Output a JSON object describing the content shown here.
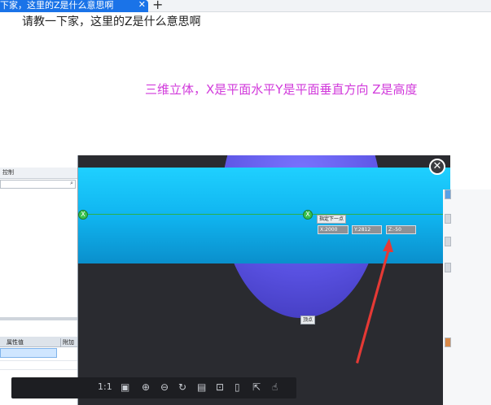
{
  "browser": {
    "tab_title": "下家，这里的Z是什么意思啊",
    "tab_close": "✕",
    "new_tab": "+"
  },
  "post": {
    "question": "请教一下家，这里的Z是什么意思啊",
    "answer": "三维立体，X是平面水平Y是平面垂直方向 Z是高度",
    "answer_color": "#d13adb"
  },
  "screenshot": {
    "left_panel": {
      "header_label": "控制",
      "search_icon": "search-icon",
      "table_headers": [
        "属性值",
        "附加"
      ]
    },
    "viewport": {
      "node_label": "X",
      "tooltip_top": "指定下一点",
      "coords": [
        "X:2000",
        "Y:2812",
        "Z:-50"
      ],
      "tooltip_bottom": "顶点",
      "sphere_color": "#5850e0",
      "band_color": "#10b5f0",
      "arrow_color": "#e53935"
    },
    "close_icon": "close-icon",
    "toolbar": {
      "ratio_label": "1:1",
      "icons": [
        "fit-screen-icon",
        "zoom-in-icon",
        "zoom-out-icon",
        "rotate-icon",
        "save-icon",
        "bookmark-icon",
        "crop-icon",
        "share-icon",
        "like-icon"
      ]
    }
  }
}
